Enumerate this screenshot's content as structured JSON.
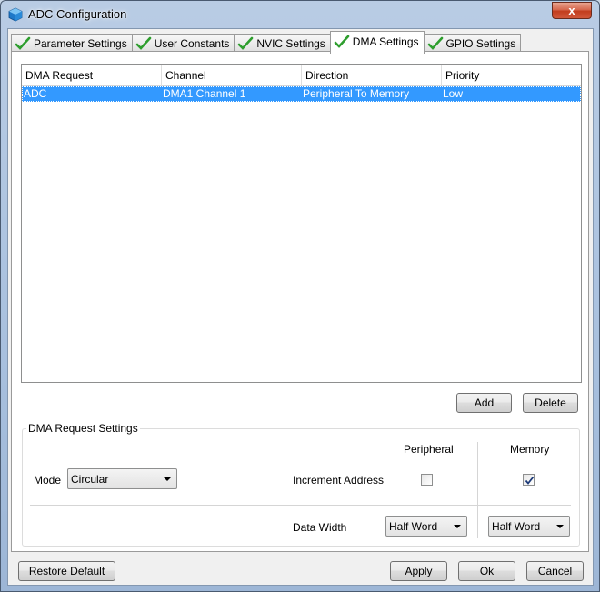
{
  "window": {
    "title": "ADC Configuration",
    "close_label": "x",
    "title_icon": "cube-app-icon"
  },
  "tabs": [
    {
      "label": "Parameter Settings",
      "icon": "green-check-icon",
      "active": false
    },
    {
      "label": "User Constants",
      "icon": "green-check-icon",
      "active": false
    },
    {
      "label": "NVIC Settings",
      "icon": "green-check-icon",
      "active": false
    },
    {
      "label": "DMA Settings",
      "icon": "green-check-icon",
      "active": true
    },
    {
      "label": "GPIO Settings",
      "icon": "green-check-icon",
      "active": false
    }
  ],
  "dma_table": {
    "columns": [
      "DMA Request",
      "Channel",
      "Direction",
      "Priority"
    ],
    "rows": [
      {
        "request": "ADC",
        "channel": "DMA1 Channel 1",
        "direction": "Peripheral To Memory",
        "priority": "Low",
        "selected": true
      }
    ]
  },
  "table_buttons": {
    "add": "Add",
    "delete": "Delete"
  },
  "request_settings": {
    "title": "DMA Request Settings",
    "mode_label": "Mode",
    "mode_value": "Circular",
    "peripheral_header": "Peripheral",
    "memory_header": "Memory",
    "increment_label": "Increment Address",
    "peripheral_increment": false,
    "memory_increment": true,
    "data_width_label": "Data Width",
    "peripheral_width": "Half Word",
    "memory_width": "Half Word"
  },
  "footer": {
    "restore": "Restore Default",
    "apply": "Apply",
    "ok": "Ok",
    "cancel": "Cancel"
  },
  "colors": {
    "selection": "#3399ff",
    "check_green": "#2e9e2e"
  }
}
